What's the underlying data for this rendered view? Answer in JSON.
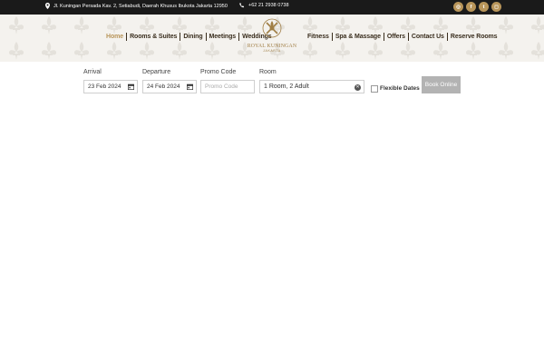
{
  "topbar": {
    "address": "Jl. Kuningan Persada Kav. 2, Setiabudi, Daerah Khusus Ibukota Jakarta 12950",
    "phone": "+62 21 2938 0738",
    "socials": [
      {
        "name": "tripadvisor-icon",
        "glyph": "◎"
      },
      {
        "name": "facebook-icon",
        "glyph": "f"
      },
      {
        "name": "twitter-icon",
        "glyph": "t"
      },
      {
        "name": "instagram-icon",
        "glyph": "◻"
      }
    ]
  },
  "nav": {
    "left": [
      "Home",
      "Rooms & Suites",
      "Dining",
      "Meetings",
      "Weddings"
    ],
    "right": [
      "Fitness",
      "Spa & Massage",
      "Offers",
      "Contact Us",
      "Reserve Rooms"
    ],
    "active": "Home"
  },
  "logo": {
    "brand": "ROYAL KUNINGAN",
    "city": "JAKARTA"
  },
  "booking": {
    "arrival_label": "Arrival",
    "arrival_value": "23 Feb 2024",
    "departure_label": "Departure",
    "departure_value": "24 Feb 2024",
    "promo_label": "Promo Code",
    "promo_placeholder": "Promo Code",
    "room_label": "Room",
    "room_value": "1 Room, 2 Adult",
    "flexible_label": "Flexible Dates",
    "book_label": "Book Online"
  },
  "colors": {
    "accent": "#b8955a",
    "topbar": "#1a1a1a",
    "button": "#b3b3b3"
  }
}
